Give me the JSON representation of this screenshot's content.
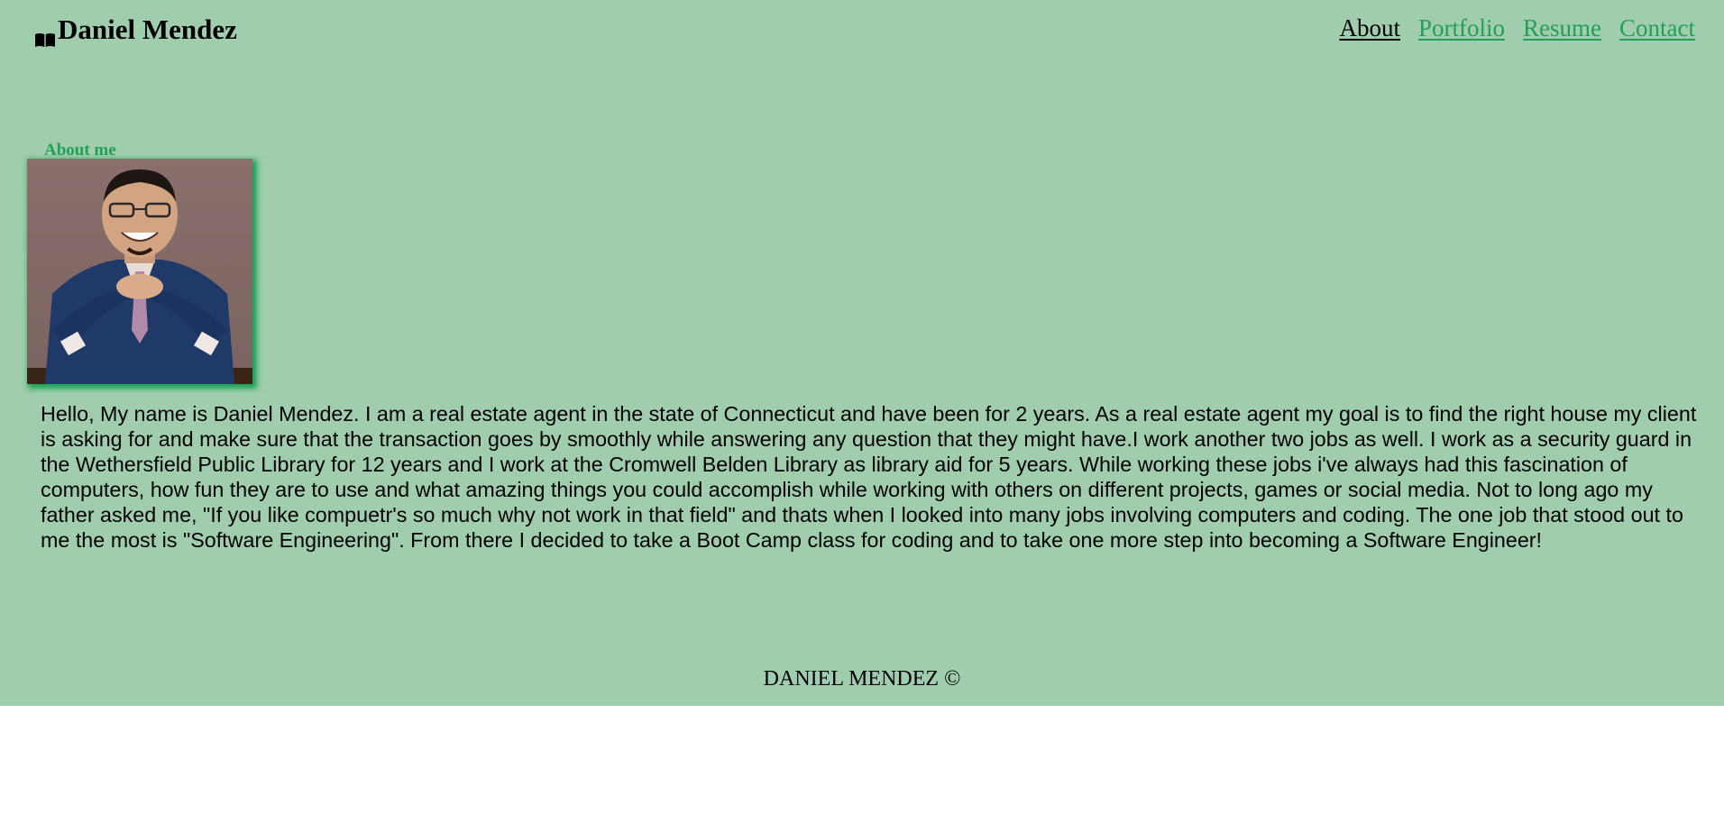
{
  "header": {
    "brand_icon": "book-open-icon",
    "brand_name": "Daniel Mendez",
    "nav": [
      {
        "label": "About",
        "active": true
      },
      {
        "label": "Portfolio",
        "active": false
      },
      {
        "label": "Resume",
        "active": false
      },
      {
        "label": "Contact",
        "active": false
      }
    ]
  },
  "main": {
    "section_title": "About me",
    "bio": "Hello, My name is Daniel Mendez. I am a real estate agent in the state of Connecticut and have been for 2 years. As a real estate agent my goal is to find the right house my client is asking for and make sure that the transaction goes by smoothly while answering any question that they might have.I work another two jobs as well. I work as a security guard in the Wethersfield Public Library for 12 years and I work at the Cromwell Belden Library as library aid for 5 years. While working these jobs i've always had this fascination of computers, how fun they are to use and what amazing things you could accomplish while working with others on different projects, games or social media. Not to long ago my father asked me, \"If you like compuetr's so much why not work in that field\" and thats when I looked into many jobs involving computers and coding. The one job that stood out to me the most is \"Software Engineering\". From there I decided to take a Boot Camp class for coding and to take one more step into becoming a Software Engineer!"
  },
  "footer": {
    "text": "DANIEL MENDEZ ©"
  },
  "colors": {
    "page_background": "#a0cdad",
    "accent": "#22a055",
    "text": "#000000"
  }
}
